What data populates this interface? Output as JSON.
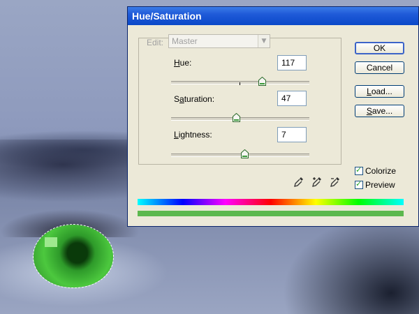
{
  "window": {
    "title": "Hue/Saturation"
  },
  "edit": {
    "label": "Edit:",
    "value": "Master"
  },
  "sliders": [
    {
      "label": "Hue:",
      "mnemonic": "H",
      "rest": "ue:",
      "value": "117",
      "position": 0.66
    },
    {
      "label": "Saturation:",
      "mnemonic": "a",
      "value": "47",
      "position": 0.47
    },
    {
      "label": "Lightness:",
      "mnemonic": "L",
      "value": "7",
      "position": 0.535
    }
  ],
  "buttons": {
    "ok": "OK",
    "cancel": "Cancel",
    "load": "Load...",
    "save": "Save..."
  },
  "checkboxes": {
    "colorize": {
      "label": "Colorize",
      "checked": true
    },
    "preview": {
      "label": "Preview",
      "checked": true
    }
  },
  "colors": {
    "accent": "#0a48c8",
    "result_color": "#5cb84e"
  },
  "icons": [
    "eyedropper-icon",
    "eyedropper-plus-icon",
    "eyedropper-minus-icon"
  ]
}
